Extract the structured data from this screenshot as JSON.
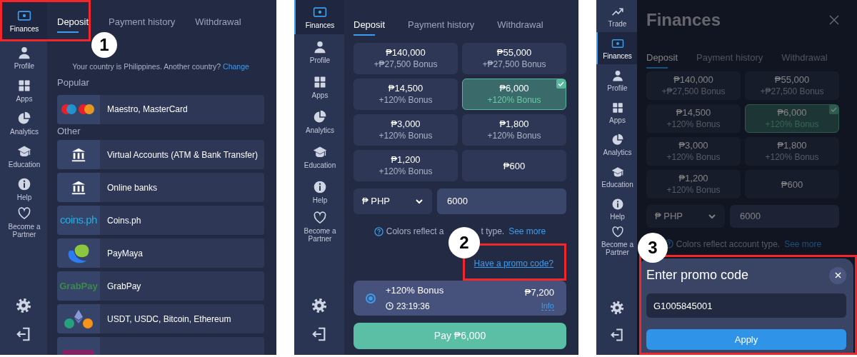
{
  "panels": [
    {
      "kind": "methods",
      "sidebar": {
        "items": [
          {
            "kind": "finances",
            "label": "Finances",
            "selected": true
          },
          {
            "kind": "profile",
            "label": "Profile",
            "selected": false
          },
          {
            "kind": "apps",
            "label": "Apps",
            "selected": false
          },
          {
            "kind": "analytics",
            "label": "Analytics",
            "selected": false
          },
          {
            "kind": "education",
            "label": "Education",
            "selected": false
          },
          {
            "kind": "help",
            "label": "Help",
            "selected": false
          },
          {
            "kind": "partner",
            "label": "Become a Partner",
            "selected": false
          }
        ]
      },
      "tabs": [
        {
          "label": "Deposit",
          "selected": true
        },
        {
          "label": "Payment history",
          "selected": false
        },
        {
          "label": "Withdrawal",
          "selected": false
        }
      ],
      "country_note": "Your country is Philippines. Another country?",
      "change_link": "Change",
      "sections": [
        {
          "title": "Popular",
          "methods": [
            {
              "kind": "cards",
              "label": "Maestro, MasterCard"
            }
          ]
        },
        {
          "title": "Other",
          "methods": [
            {
              "kind": "bank",
              "label": "Virtual Accounts (ATM & Bank Transfer)"
            },
            {
              "kind": "bank",
              "label": "Online banks"
            },
            {
              "kind": "coins",
              "logo_text": "coins.ph",
              "label": "Coins.ph"
            },
            {
              "kind": "paymaya",
              "label": "PayMaya"
            },
            {
              "kind": "grabpay",
              "logo_text": "GrabPay",
              "label": "GrabPay"
            },
            {
              "kind": "crypto",
              "label": "USDT, USDC, Bitcoin, Ethereum"
            },
            {
              "kind": "skrill"
            }
          ]
        }
      ],
      "callout": {
        "number": "1"
      }
    },
    {
      "kind": "amounts",
      "sidebar": {
        "items": [
          {
            "kind": "finances",
            "label": "Finances",
            "selected": true
          },
          {
            "kind": "profile",
            "label": "Profile",
            "selected": false
          },
          {
            "kind": "apps",
            "label": "Apps",
            "selected": false
          },
          {
            "kind": "analytics",
            "label": "Analytics",
            "selected": false
          },
          {
            "kind": "education",
            "label": "Education",
            "selected": false
          },
          {
            "kind": "help",
            "label": "Help",
            "selected": false
          },
          {
            "kind": "partner",
            "label": "Become a Partner",
            "selected": false
          }
        ]
      },
      "tabs": [
        {
          "label": "Deposit",
          "selected": true
        },
        {
          "label": "Payment history",
          "selected": false
        },
        {
          "label": "Withdrawal",
          "selected": false
        }
      ],
      "amounts": [
        {
          "amount": "₱140,000",
          "bonus": "+₱27,500 Bonus",
          "selected": false
        },
        {
          "amount": "₱55,000",
          "bonus": "+₱27,500 Bonus",
          "selected": false
        },
        {
          "amount": "₱14,500",
          "bonus": "+120% Bonus",
          "selected": false
        },
        {
          "amount": "₱6,000",
          "bonus": "+120% Bonus",
          "selected": true
        },
        {
          "amount": "₱3,000",
          "bonus": "+120% Bonus",
          "selected": false
        },
        {
          "amount": "₱1,800",
          "bonus": "+120% Bonus",
          "selected": false
        },
        {
          "amount": "₱1,200",
          "bonus": "+120% Bonus",
          "selected": false
        },
        {
          "amount": "₱600",
          "selected": false
        }
      ],
      "currency": "₱ PHP",
      "amount_value": "6000",
      "note_parts": [
        "Colors reflect a",
        "t type."
      ],
      "see_more": "See more",
      "promo_link": "Have a promo code?",
      "bonus_offer": {
        "selected": true,
        "title": "+120% Bonus",
        "timer": "23:19:36",
        "amount": "₱7,200",
        "info": "Info"
      },
      "pay_button": "Pay ₱6,000",
      "callout": {
        "number": "2"
      }
    },
    {
      "kind": "promo",
      "sidebar": {
        "items": [
          {
            "kind": "trade",
            "label": "Trade",
            "selected": false
          },
          {
            "kind": "finances",
            "label": "Finances",
            "selected": true
          },
          {
            "kind": "profile",
            "label": "Profile",
            "selected": false
          },
          {
            "kind": "apps",
            "label": "Apps",
            "selected": false
          },
          {
            "kind": "analytics",
            "label": "Analytics",
            "selected": false
          },
          {
            "kind": "education",
            "label": "Education",
            "selected": false
          },
          {
            "kind": "help",
            "label": "Help",
            "selected": false
          },
          {
            "kind": "partner",
            "label": "Become a Partner",
            "selected": false
          }
        ]
      },
      "title": "Finances",
      "tabs": [
        {
          "label": "Deposit",
          "selected": true
        },
        {
          "label": "Payment history",
          "selected": false
        },
        {
          "label": "Withdrawal",
          "selected": false
        }
      ],
      "amounts": [
        {
          "amount": "₱140,000",
          "bonus": "+₱27,500 Bonus",
          "selected": false
        },
        {
          "amount": "₱55,000",
          "bonus": "+₱27,500 Bonus",
          "selected": false
        },
        {
          "amount": "₱14,500",
          "bonus": "+120% Bonus",
          "selected": false
        },
        {
          "amount": "₱6,000",
          "bonus": "+120% Bonus",
          "selected": true
        },
        {
          "amount": "₱3,000",
          "bonus": "+120% Bonus",
          "selected": false
        },
        {
          "amount": "₱1,800",
          "bonus": "+120% Bonus",
          "selected": false
        },
        {
          "amount": "₱1,200",
          "bonus": "+120% Bonus",
          "selected": false
        },
        {
          "amount": "₱600",
          "selected": false
        }
      ],
      "currency": "₱ PHP",
      "amount_value": "6000",
      "note_parts": [
        "Colors reflect account type."
      ],
      "see_more": "See more",
      "promo_sheet": {
        "title": "Enter promo code",
        "code": "G1005845001",
        "apply": "Apply"
      },
      "callout": {
        "number": "3"
      }
    }
  ]
}
